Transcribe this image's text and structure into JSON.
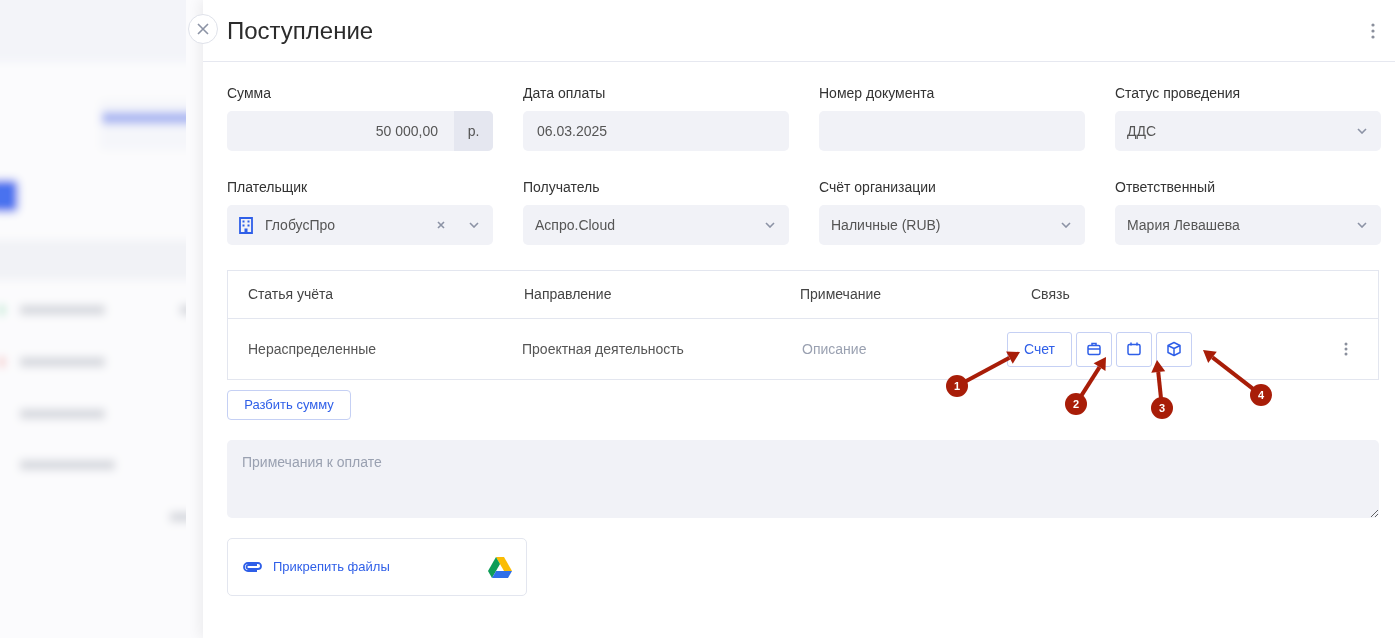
{
  "panel": {
    "title": "Поступление"
  },
  "fields": [
    {
      "label": "Сумма",
      "kind": "amount",
      "value": "50 000,00",
      "unit": "р."
    },
    {
      "label": "Дата оплаты",
      "kind": "text",
      "value": "06.03.2025"
    },
    {
      "label": "Номер документа",
      "kind": "text"
    },
    {
      "label": "Статус проведения",
      "kind": "select",
      "value": "ДДС"
    },
    {
      "label": "Плательщик",
      "kind": "select",
      "value": "ГлобусПро",
      "building_icon": true,
      "clearable": true
    },
    {
      "label": "Получатель",
      "kind": "select",
      "value": "Аспро.Cloud"
    },
    {
      "label": "Счёт организации",
      "kind": "select",
      "value": "Наличные (RUB)"
    },
    {
      "label": "Ответственный",
      "kind": "select",
      "value": "Мария Левашева"
    }
  ],
  "table": {
    "columns": [
      "Статья учёта",
      "Направление",
      "Примечание",
      "Связь"
    ],
    "rows": [
      {
        "article": "Нераспределенные",
        "direction": "Проектная деятельность",
        "note_placeholder": "Описание",
        "link_button": "Счет",
        "link_buttons": [
          {
            "kind": "briefcase"
          },
          {
            "kind": "calendar"
          },
          {
            "kind": "cube"
          }
        ]
      }
    ]
  },
  "split_button": "Разбить сумму",
  "notes": {
    "placeholder": "Примечания к оплате"
  },
  "attach": {
    "label": "Прикрепить файлы"
  },
  "annotations": [
    {
      "label": "1"
    },
    {
      "label": "2"
    },
    {
      "label": "3"
    },
    {
      "label": "4"
    }
  ]
}
